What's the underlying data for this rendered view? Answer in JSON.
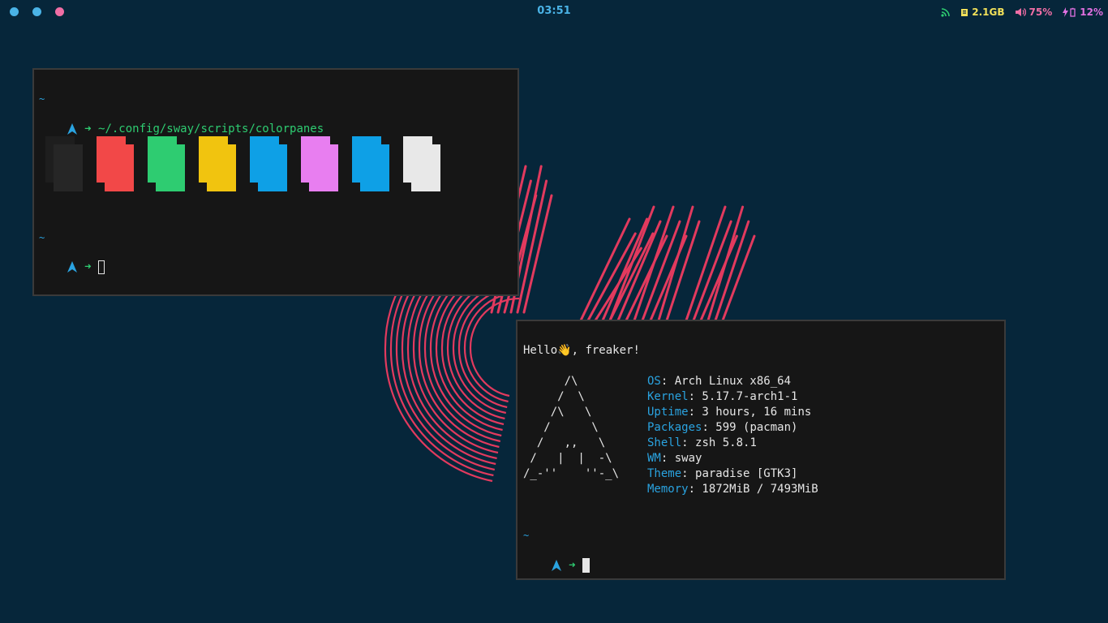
{
  "topbar": {
    "workspaces": [
      {
        "name": "workspace-1",
        "color": "#4ab3e6"
      },
      {
        "name": "workspace-2",
        "color": "#4ab3e6"
      },
      {
        "name": "workspace-3",
        "color": "#f06ea5"
      }
    ],
    "clock": "03:51",
    "status": {
      "network_icon": "rss-icon",
      "memory_icon": "memory-chip-icon",
      "memory": "2.1GB",
      "volume_icon": "speaker-icon",
      "volume": "75%",
      "battery_icon": "charging-battery-icon",
      "battery": "12%",
      "colors": {
        "network": "#2ecc71",
        "memory": "#f1e05a",
        "volume": "#f06ea5",
        "battery": "#e070e0"
      }
    }
  },
  "terminal1": {
    "prompt1_dir": "~",
    "prompt1_command": "~/.config/sway/scripts/colorpanes",
    "prompt2_dir": "~",
    "pane_colors": [
      "#222222",
      "#f24848",
      "#2ecc71",
      "#f1c40f",
      "#0ea0e6",
      "#e87ef0",
      "#0ea0e6",
      "#e8e8e8"
    ]
  },
  "terminal2": {
    "greeting_prefix": "Hello",
    "greeting_emoji": "👋",
    "greeting_suffix": ", freaker!",
    "ascii_art": [
      "      /\\",
      "     /  \\",
      "    /\\   \\",
      "   /      \\",
      "  /   ,,   \\",
      " /   |  |  -\\",
      "/_-''    ''-_\\"
    ],
    "info": [
      {
        "key": "OS",
        "value": ": Arch Linux x86_64"
      },
      {
        "key": "Kernel",
        "value": ": 5.17.7-arch1-1"
      },
      {
        "key": "Uptime",
        "value": ": 3 hours, 16 mins"
      },
      {
        "key": "Packages",
        "value": ": 599 (pacman)"
      },
      {
        "key": "Shell",
        "value": ": zsh 5.8.1"
      },
      {
        "key": "WM",
        "value": ": sway"
      },
      {
        "key": "Theme",
        "value": ": paradise [GTK3]"
      },
      {
        "key": "Memory",
        "value": ": 1872MiB / 7493MiB"
      }
    ],
    "prompt_dir": "~"
  },
  "accent_arrow_color": "#2ecc71",
  "arch_icon_color": "#2aa3e0",
  "wallpaper_line_color": "#e23a5e"
}
